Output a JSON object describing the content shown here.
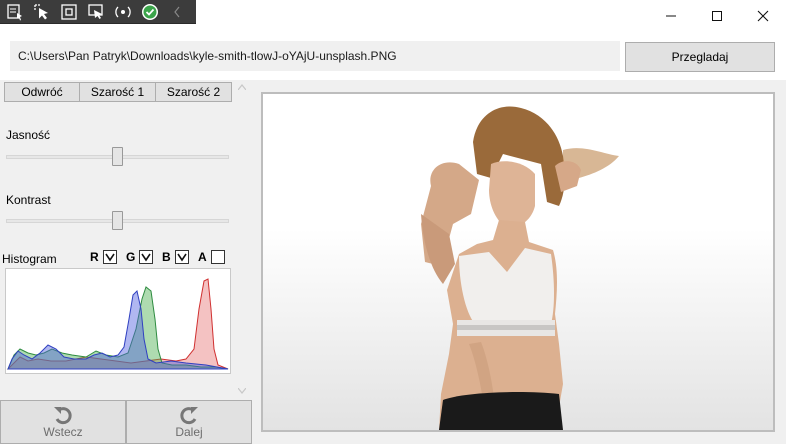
{
  "path": {
    "value": "C:\\Users\\Pan Patryk\\Downloads\\kyle-smith-tlowJ-oYAjU-unsplash.PNG"
  },
  "browse_label": "Przegladaj",
  "filters": [
    "Odwróć",
    "Szarość 1",
    "Szarość 2"
  ],
  "brightness": {
    "label": "Jasność",
    "value": 0.5
  },
  "contrast": {
    "label": "Kontrast",
    "value": 0.5
  },
  "histogram": {
    "label": "Histogram",
    "channels": [
      {
        "name": "R",
        "checked": true,
        "color": "#e05050"
      },
      {
        "name": "G",
        "checked": true,
        "color": "#4caf50"
      },
      {
        "name": "B",
        "checked": true,
        "color": "#5060e0"
      },
      {
        "name": "A",
        "checked": false
      }
    ]
  },
  "nav": {
    "back_label": "Wstecz",
    "next_label": "Dalej"
  },
  "icons": [
    "debug-select-icon",
    "debug-inspect-icon",
    "debug-frame-icon",
    "debug-track-icon",
    "debug-hotreload-icon",
    "debug-ok-icon",
    "collapse-icon",
    "minimize-icon",
    "maximize-icon",
    "close-icon",
    "undo-icon",
    "redo-icon",
    "scroll-up-icon",
    "scroll-down-icon"
  ]
}
